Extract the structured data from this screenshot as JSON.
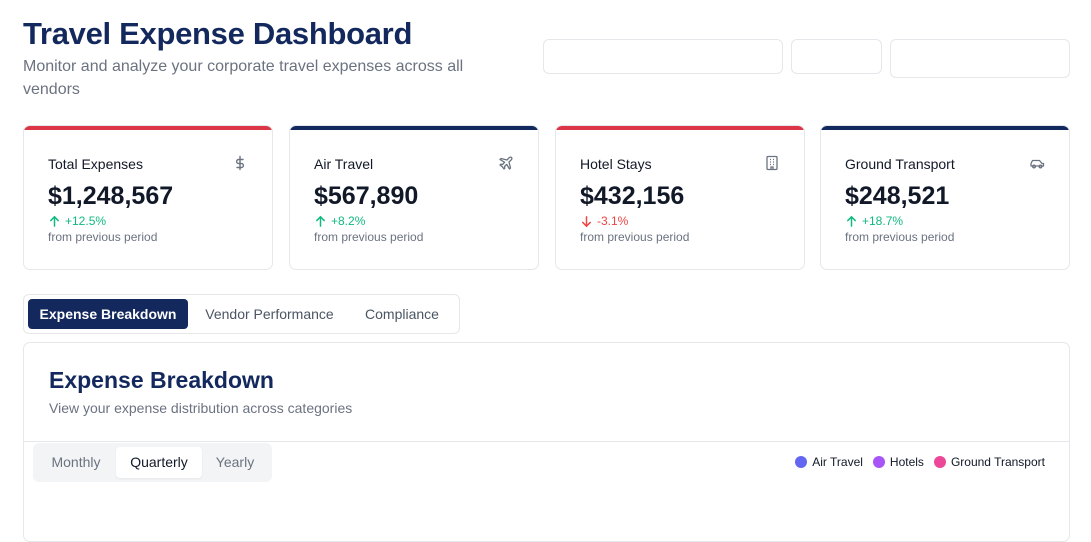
{
  "header": {
    "title": "Travel Expense Dashboard",
    "subtitle": "Monitor and analyze your corporate travel expenses across all vendors"
  },
  "controls": {
    "date_range": "",
    "period": "",
    "vendor": ""
  },
  "cards": [
    {
      "label": "Total Expenses",
      "value": "$1,248,567",
      "change": "+12.5%",
      "direction": "up",
      "period": "from previous period",
      "icon": "dollar-icon",
      "accent": "#dc3545"
    },
    {
      "label": "Air Travel",
      "value": "$567,890",
      "change": "+8.2%",
      "direction": "up",
      "period": "from previous period",
      "icon": "plane-icon",
      "accent": "#13285c"
    },
    {
      "label": "Hotel Stays",
      "value": "$432,156",
      "change": "-3.1%",
      "direction": "down",
      "period": "from previous period",
      "icon": "building-icon",
      "accent": "#dc3545"
    },
    {
      "label": "Ground Transport",
      "value": "$248,521",
      "change": "+18.7%",
      "direction": "up",
      "period": "from previous period",
      "icon": "car-icon",
      "accent": "#13285c"
    }
  ],
  "tabs": [
    {
      "label": "Expense Breakdown",
      "active": true
    },
    {
      "label": "Vendor Performance",
      "active": false
    },
    {
      "label": "Compliance",
      "active": false
    }
  ],
  "panel": {
    "title": "Expense Breakdown",
    "subtitle": "View your expense distribution across categories",
    "periods": [
      {
        "label": "Monthly",
        "active": false
      },
      {
        "label": "Quarterly",
        "active": true
      },
      {
        "label": "Yearly",
        "active": false
      }
    ],
    "legend": [
      {
        "label": "Air Travel",
        "color": "#6366f1"
      },
      {
        "label": "Hotels",
        "color": "#a855f7"
      },
      {
        "label": "Ground Transport",
        "color": "#ec4899"
      }
    ]
  },
  "colors": {
    "brand": "#13285c",
    "positive": "#10b981",
    "negative": "#ef4444"
  }
}
